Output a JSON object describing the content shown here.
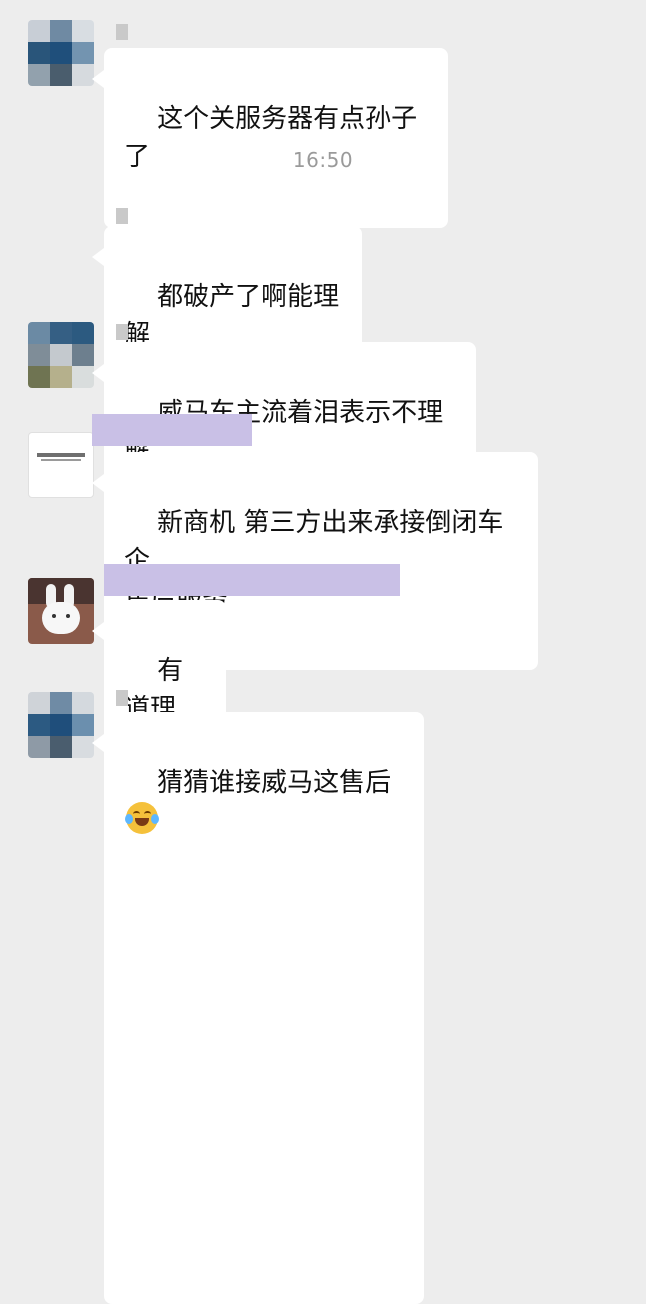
{
  "chat": {
    "timestamp": "16:50",
    "messages": [
      {
        "text": "这个关服务器有点孙子了"
      },
      {
        "text": "都破产了啊能理解"
      },
      {
        "text": "威马车主流着泪表示不理解"
      },
      {
        "text": "新商机 第三方出来承接倒闭车企\n售后服务"
      },
      {
        "text": "有道理"
      },
      {
        "text": "猜猜谁接威马这售后",
        "emoji": "laughing-crying-emoji"
      }
    ]
  },
  "colors": {
    "background": "#ededed",
    "bubble": "#ffffff",
    "timestamp": "#9a9a9a",
    "name_mask": "#c9c0e6"
  }
}
